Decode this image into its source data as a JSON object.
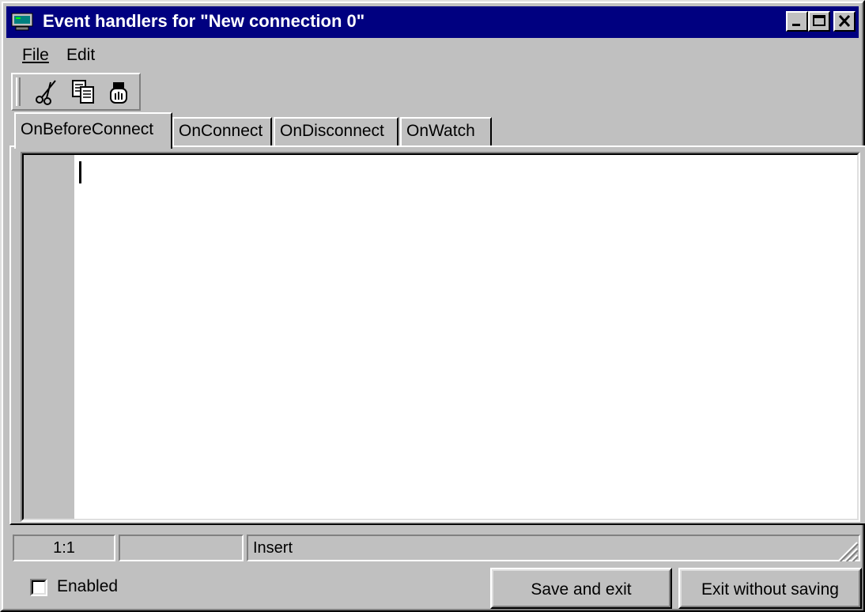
{
  "window": {
    "title": "Event handlers for \"New connection 0\"",
    "controls": [
      "minimize",
      "maximize",
      "close"
    ]
  },
  "menu": {
    "file_label": "File",
    "edit_label": "Edit"
  },
  "toolbar": {
    "icons": [
      "cut-icon",
      "copy-icon",
      "paste-icon"
    ]
  },
  "tabs": [
    {
      "label": "OnBeforeConnect",
      "active": true
    },
    {
      "label": "OnConnect",
      "active": false
    },
    {
      "label": "OnDisconnect",
      "active": false
    },
    {
      "label": "OnWatch",
      "active": false
    }
  ],
  "editor": {
    "content": ""
  },
  "status": {
    "position": "1:1",
    "middle": "",
    "mode": "Insert"
  },
  "footer": {
    "enabled_label": "Enabled",
    "enabled_checked": false,
    "save_label": "Save and exit",
    "exit_label": "Exit without saving"
  },
  "colors": {
    "titlebar": "#000080",
    "face": "#c0c0c0",
    "editor_bg": "#ffffff"
  }
}
